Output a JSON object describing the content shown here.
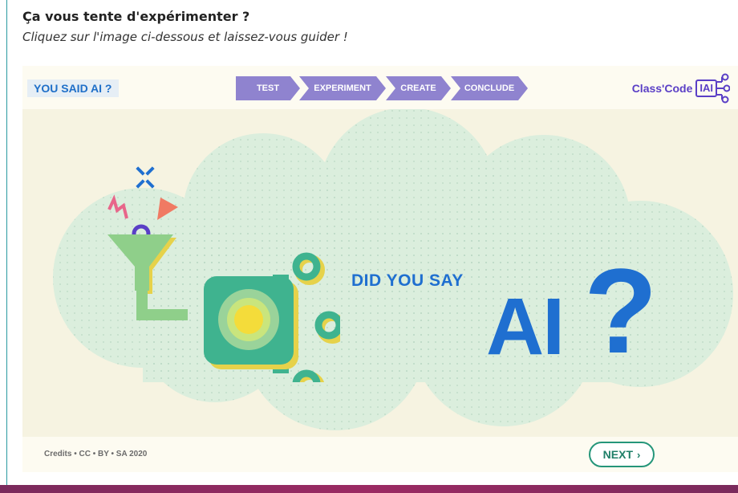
{
  "page": {
    "heading": "Ça vous tente d'expérimenter ?",
    "subheading": "Cliquez sur l'image ci-dessous et laissez-vous guider !"
  },
  "activity": {
    "badge": "YOU SAID AI ?",
    "steps": [
      "TEST",
      "EXPERIMENT",
      "CREATE",
      "CONCLUDE"
    ],
    "logo_text": "Class'Code",
    "logo_box": "IAI",
    "headline": "DID YOU SAY",
    "big_text": "AI",
    "big_mark": "?",
    "credits": "Credits • CC • BY • SA 2020",
    "next_label": "NEXT"
  },
  "colors": {
    "accent_purple": "#8f83cf",
    "brand_blue": "#1f6fd0",
    "cloud_green": "#dcefe0",
    "chip_green": "#3fb38f",
    "next_border": "#25967a"
  },
  "icons": {
    "circuit": "circuit-icon",
    "funnel": "funnel-icon",
    "sparkle": "sparkle-icon",
    "chevron": "chevron-right-icon",
    "network_logo": "network-icon"
  }
}
